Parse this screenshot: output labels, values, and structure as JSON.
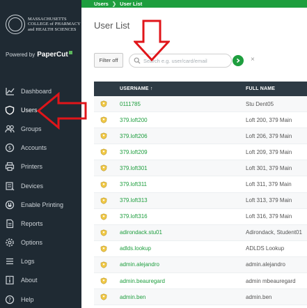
{
  "logo": {
    "lines": [
      "MASSACHUSETTS",
      "COLLEGE of PHARMACY",
      "and HEALTH SCIENCES"
    ]
  },
  "powered": {
    "prefix": "Powered by",
    "brand": "PaperCut"
  },
  "nav": [
    {
      "label": "Dashboard",
      "icon": "chart-line-icon",
      "active": false
    },
    {
      "label": "Users",
      "icon": "shield-icon",
      "active": true
    },
    {
      "label": "Groups",
      "icon": "group-icon",
      "active": false
    },
    {
      "label": "Accounts",
      "icon": "coin-icon",
      "active": false
    },
    {
      "label": "Printers",
      "icon": "printer-icon",
      "active": false
    },
    {
      "label": "Devices",
      "icon": "device-icon",
      "active": false
    },
    {
      "label": "Enable Printing",
      "icon": "plug-icon",
      "active": false
    },
    {
      "label": "Reports",
      "icon": "report-icon",
      "active": false
    },
    {
      "label": "Options",
      "icon": "gear-icon",
      "active": false
    },
    {
      "label": "Logs",
      "icon": "list-icon",
      "active": false
    },
    {
      "label": "About",
      "icon": "info-icon",
      "active": false
    },
    {
      "label": "Help",
      "icon": "help-icon",
      "active": false
    }
  ],
  "breadcrumb": {
    "root": "Users",
    "current": "User List"
  },
  "page": {
    "title": "User List"
  },
  "toolbar": {
    "filter_label": "Filter off",
    "search_placeholder": "Search e.g. user/card/email",
    "clear_label": "×"
  },
  "table": {
    "columns": {
      "username": "USERNAME",
      "sort_indicator": "↑",
      "full_name": "FULL NAME"
    },
    "rows": [
      {
        "username": "0111785",
        "full_name": "Stu Dent05"
      },
      {
        "username": "379.loft200",
        "full_name": "Loft 200, 379 Main"
      },
      {
        "username": "379.loft206",
        "full_name": "Loft 206, 379 Main"
      },
      {
        "username": "379.loft209",
        "full_name": "Loft 209, 379 Main"
      },
      {
        "username": "379.loft301",
        "full_name": "Loft 301, 379 Main"
      },
      {
        "username": "379.loft311",
        "full_name": "Loft 311, 379 Main"
      },
      {
        "username": "379.loft313",
        "full_name": "Loft 313, 379 Main"
      },
      {
        "username": "379.loft316",
        "full_name": "Loft 316, 379 Main"
      },
      {
        "username": "adirondack.stu01",
        "full_name": "Adirondack, Student01"
      },
      {
        "username": "adlds.lookup",
        "full_name": "ADLDS Lookup"
      },
      {
        "username": "admin.alejandro",
        "full_name": "admin.alejandro"
      },
      {
        "username": "admin.beauregard",
        "full_name": "admin mbeauregard"
      },
      {
        "username": "admin.ben",
        "full_name": "admin.ben"
      }
    ]
  },
  "colors": {
    "sidebar_bg": "#1f2a33",
    "accent_green": "#1e9e3e",
    "table_header_bg": "#2d3a44",
    "annotation_red": "#e0151a"
  }
}
